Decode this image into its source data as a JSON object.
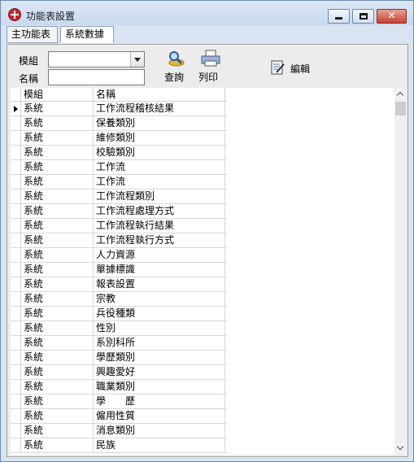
{
  "window": {
    "title": "功能表設置"
  },
  "tabs": [
    {
      "label": "主功能表"
    },
    {
      "label": "系統數據"
    }
  ],
  "filters": {
    "module_label": "模組",
    "module_value": "",
    "name_label": "名稱",
    "name_value": ""
  },
  "toolbar": {
    "query_label": "查詢",
    "print_label": "列印",
    "edit_label": "編輯"
  },
  "grid": {
    "columns": [
      "模組",
      "名稱"
    ],
    "selected_row": 0,
    "rows": [
      [
        "系統",
        "工作流程稽核結果"
      ],
      [
        "系統",
        "保養類別"
      ],
      [
        "系統",
        "維修類別"
      ],
      [
        "系統",
        "校驗類別"
      ],
      [
        "系統",
        "工作流"
      ],
      [
        "系統",
        "工作流"
      ],
      [
        "系統",
        "工作流程類別"
      ],
      [
        "系統",
        "工作流程處理方式"
      ],
      [
        "系統",
        "工作流程執行結果"
      ],
      [
        "系統",
        "工作流程執行方式"
      ],
      [
        "系統",
        "人力資源"
      ],
      [
        "系統",
        "單據標識"
      ],
      [
        "系統",
        "報表設置"
      ],
      [
        "系統",
        "宗教"
      ],
      [
        "系統",
        "兵役種類"
      ],
      [
        "系統",
        "性別"
      ],
      [
        "系統",
        "系別科所"
      ],
      [
        "系統",
        "學歷類別"
      ],
      [
        "系統",
        "興趣愛好"
      ],
      [
        "系統",
        "職業類別"
      ],
      [
        "系統",
        "學　　歷"
      ],
      [
        "系統",
        "僱用性質"
      ],
      [
        "系統",
        "消息類別"
      ],
      [
        "系統",
        "民族"
      ]
    ]
  },
  "colors": {
    "titlebar": "#c9d9ee",
    "close_button": "#c7432e",
    "client_bg": "#ececec"
  }
}
